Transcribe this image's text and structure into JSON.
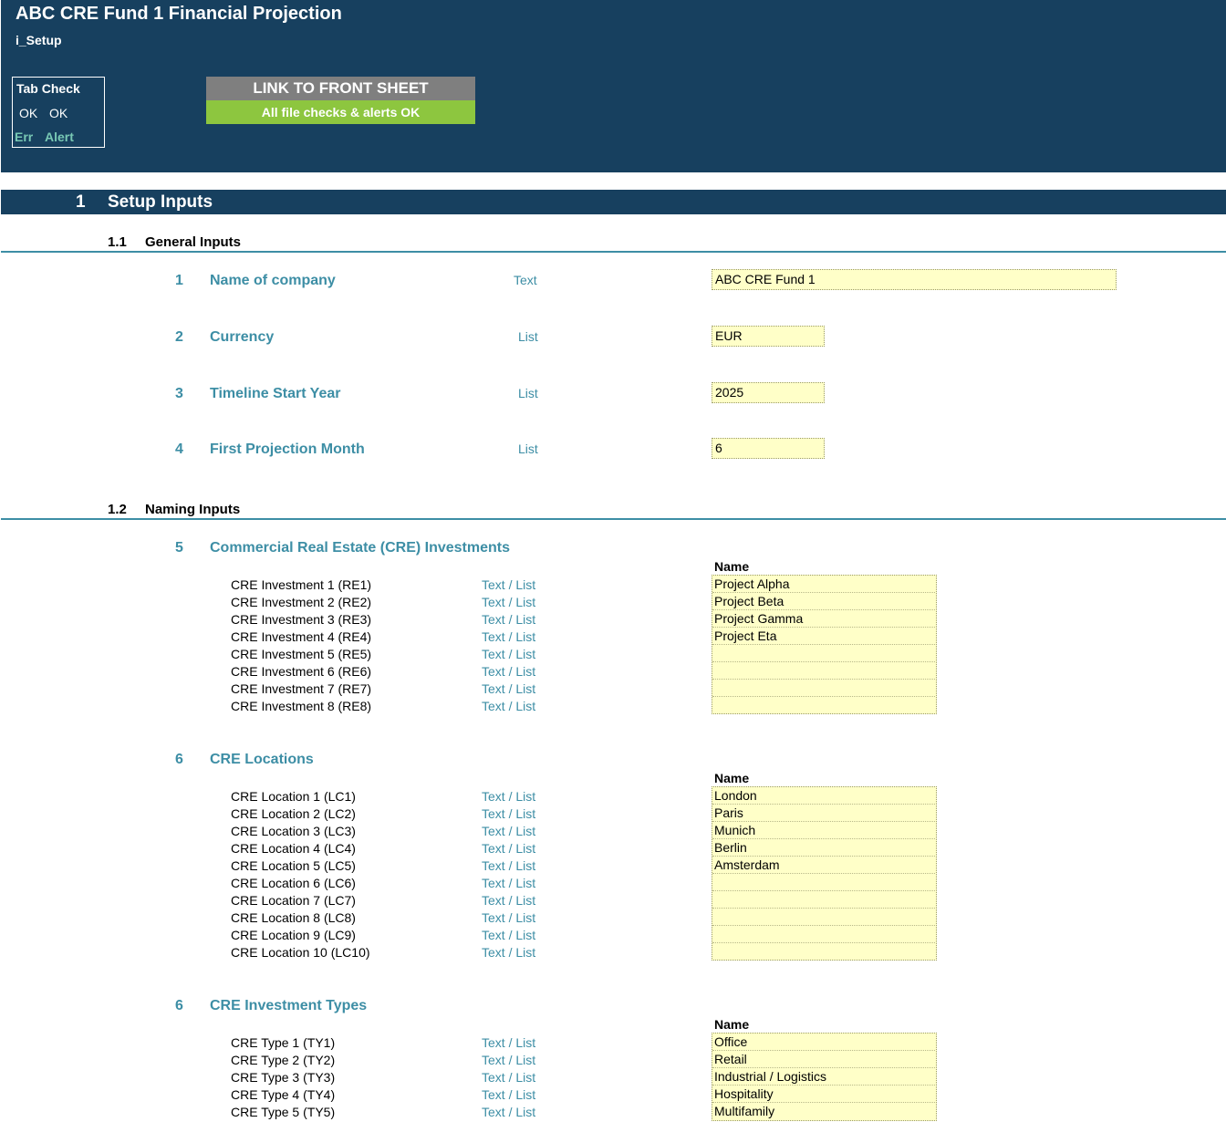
{
  "header": {
    "title": "ABC CRE Fund 1 Financial Projection",
    "sheet": "i_Setup",
    "tab_check": {
      "label": "Tab Check",
      "ok1": "OK",
      "ok2": "OK",
      "err": "Err",
      "alert": "Alert"
    },
    "link_button": "LINK TO FRONT SHEET",
    "checks_status": "All file checks & alerts OK"
  },
  "section": {
    "number": "1",
    "title": "Setup Inputs"
  },
  "general": {
    "number": "1.1",
    "title": "General Inputs",
    "items": [
      {
        "num": "1",
        "label": "Name of company",
        "type": "Text",
        "value": "ABC CRE Fund 1"
      },
      {
        "num": "2",
        "label": "Currency",
        "type": "List",
        "value": "EUR"
      },
      {
        "num": "3",
        "label": "Timeline Start Year",
        "type": "List",
        "value": "2025"
      },
      {
        "num": "4",
        "label": "First Projection Month",
        "type": "List",
        "value": "6"
      }
    ]
  },
  "naming": {
    "number": "1.2",
    "title": "Naming Inputs",
    "groups": [
      {
        "num": "5",
        "label": "Commercial Real Estate (CRE) Investments",
        "name_header": "Name",
        "rows": [
          {
            "label": "CRE Investment 1 (RE1)",
            "type": "Text / List",
            "value": "Project Alpha"
          },
          {
            "label": "CRE Investment 2 (RE2)",
            "type": "Text / List",
            "value": "Project Beta"
          },
          {
            "label": "CRE Investment 3 (RE3)",
            "type": "Text / List",
            "value": "Project Gamma"
          },
          {
            "label": "CRE Investment 4 (RE4)",
            "type": "Text / List",
            "value": "Project Eta"
          },
          {
            "label": "CRE Investment 5 (RE5)",
            "type": "Text / List",
            "value": ""
          },
          {
            "label": "CRE Investment 6 (RE6)",
            "type": "Text / List",
            "value": ""
          },
          {
            "label": "CRE Investment 7 (RE7)",
            "type": "Text / List",
            "value": ""
          },
          {
            "label": "CRE Investment 8 (RE8)",
            "type": "Text / List",
            "value": ""
          }
        ]
      },
      {
        "num": "6",
        "label": "CRE Locations",
        "name_header": "Name",
        "rows": [
          {
            "label": "CRE Location 1 (LC1)",
            "type": "Text / List",
            "value": "London"
          },
          {
            "label": "CRE Location 2 (LC2)",
            "type": "Text / List",
            "value": "Paris"
          },
          {
            "label": "CRE Location 3 (LC3)",
            "type": "Text / List",
            "value": "Munich"
          },
          {
            "label": "CRE Location 4 (LC4)",
            "type": "Text / List",
            "value": "Berlin"
          },
          {
            "label": "CRE Location 5 (LC5)",
            "type": "Text / List",
            "value": "Amsterdam"
          },
          {
            "label": "CRE Location 6 (LC6)",
            "type": "Text / List",
            "value": ""
          },
          {
            "label": "CRE Location 7 (LC7)",
            "type": "Text / List",
            "value": ""
          },
          {
            "label": "CRE Location 8 (LC8)",
            "type": "Text / List",
            "value": ""
          },
          {
            "label": "CRE Location 9 (LC9)",
            "type": "Text / List",
            "value": ""
          },
          {
            "label": "CRE Location 10 (LC10)",
            "type": "Text / List",
            "value": ""
          }
        ]
      },
      {
        "num": "6",
        "label": "CRE Investment Types",
        "name_header": "Name",
        "rows": [
          {
            "label": "CRE Type 1 (TY1)",
            "type": "Text / List",
            "value": "Office"
          },
          {
            "label": "CRE Type 2 (TY2)",
            "type": "Text / List",
            "value": "Retail"
          },
          {
            "label": "CRE Type 3 (TY3)",
            "type": "Text / List",
            "value": "Industrial / Logistics"
          },
          {
            "label": "CRE Type 4 (TY4)",
            "type": "Text / List",
            "value": "Hospitality"
          },
          {
            "label": "CRE Type 5 (TY5)",
            "type": "Text / List",
            "value": "Multifamily"
          }
        ]
      }
    ]
  },
  "colors": {
    "banner": "#17405f",
    "accent": "#3d8ea5",
    "input_fill": "#ffffc8",
    "ok_green": "#8dc63f",
    "button_grey": "#7f7f7f",
    "alert_teal": "#78c8b4"
  }
}
